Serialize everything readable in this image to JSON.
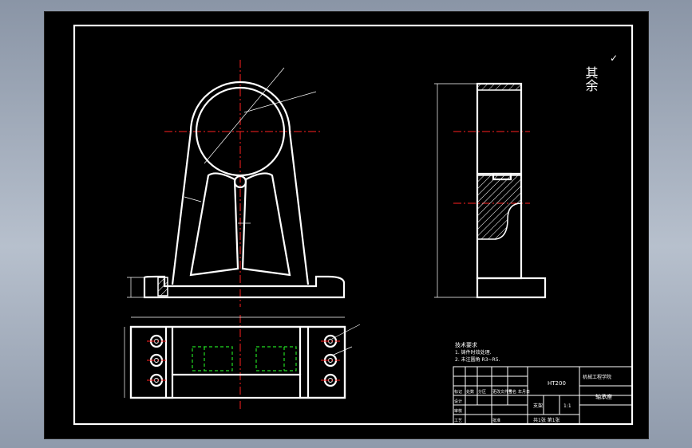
{
  "surface_roughness": {
    "label": "其余",
    "mark": "✓"
  },
  "technical_requirements": {
    "title": "技术要求",
    "items": [
      "1. 铸件时效处理.",
      "2. 未注圆角 R3~R5."
    ]
  },
  "title_block": {
    "drawing_name": "轴承座",
    "part_name": "支架",
    "scale": "1:1",
    "school": "机械工程学院",
    "sheet": "共1张 第1张",
    "material": "HT200",
    "rows": [
      "标记",
      "处数",
      "分区",
      "更改文件号",
      "签名",
      "年月日"
    ],
    "roles": [
      "设计",
      "审核",
      "工艺",
      "批准"
    ]
  },
  "colors": {
    "background": "#000000",
    "frame": "#ffffff",
    "centerline": "#ff2020",
    "hidden": "#22dd22"
  }
}
